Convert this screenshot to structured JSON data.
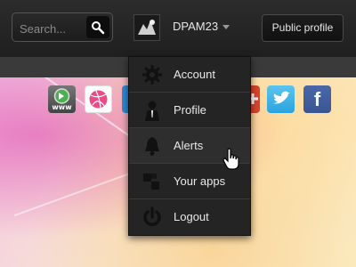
{
  "header": {
    "search": {
      "placeholder": "Search...",
      "icon": "search-icon"
    },
    "user": {
      "name": "DPAM23",
      "avatar": "avatar-image",
      "caret_icon": "caret-down-icon"
    },
    "public_profile_label": "Public profile"
  },
  "dropdown": {
    "items": [
      {
        "label": "Account",
        "icon": "gear-icon"
      },
      {
        "label": "Profile",
        "icon": "person-icon"
      },
      {
        "label": "Alerts",
        "icon": "bell-icon",
        "hovered": true
      },
      {
        "label": "Your apps",
        "icon": "apps-icon"
      },
      {
        "label": "Logout",
        "icon": "power-icon"
      }
    ]
  },
  "social_icons": [
    {
      "name": "www-icon",
      "text": "www"
    },
    {
      "name": "dribbble-icon"
    },
    {
      "name": "blue-app-icon"
    },
    {
      "name": "google-plus-icon"
    },
    {
      "name": "twitter-icon"
    },
    {
      "name": "facebook-icon",
      "text": "f"
    }
  ],
  "colors": {
    "topbar": "#242424",
    "menu_bg": "#242424",
    "menu_text": "#e8e8e8",
    "twitter": "#2aa3de",
    "facebook": "#3b5998"
  }
}
